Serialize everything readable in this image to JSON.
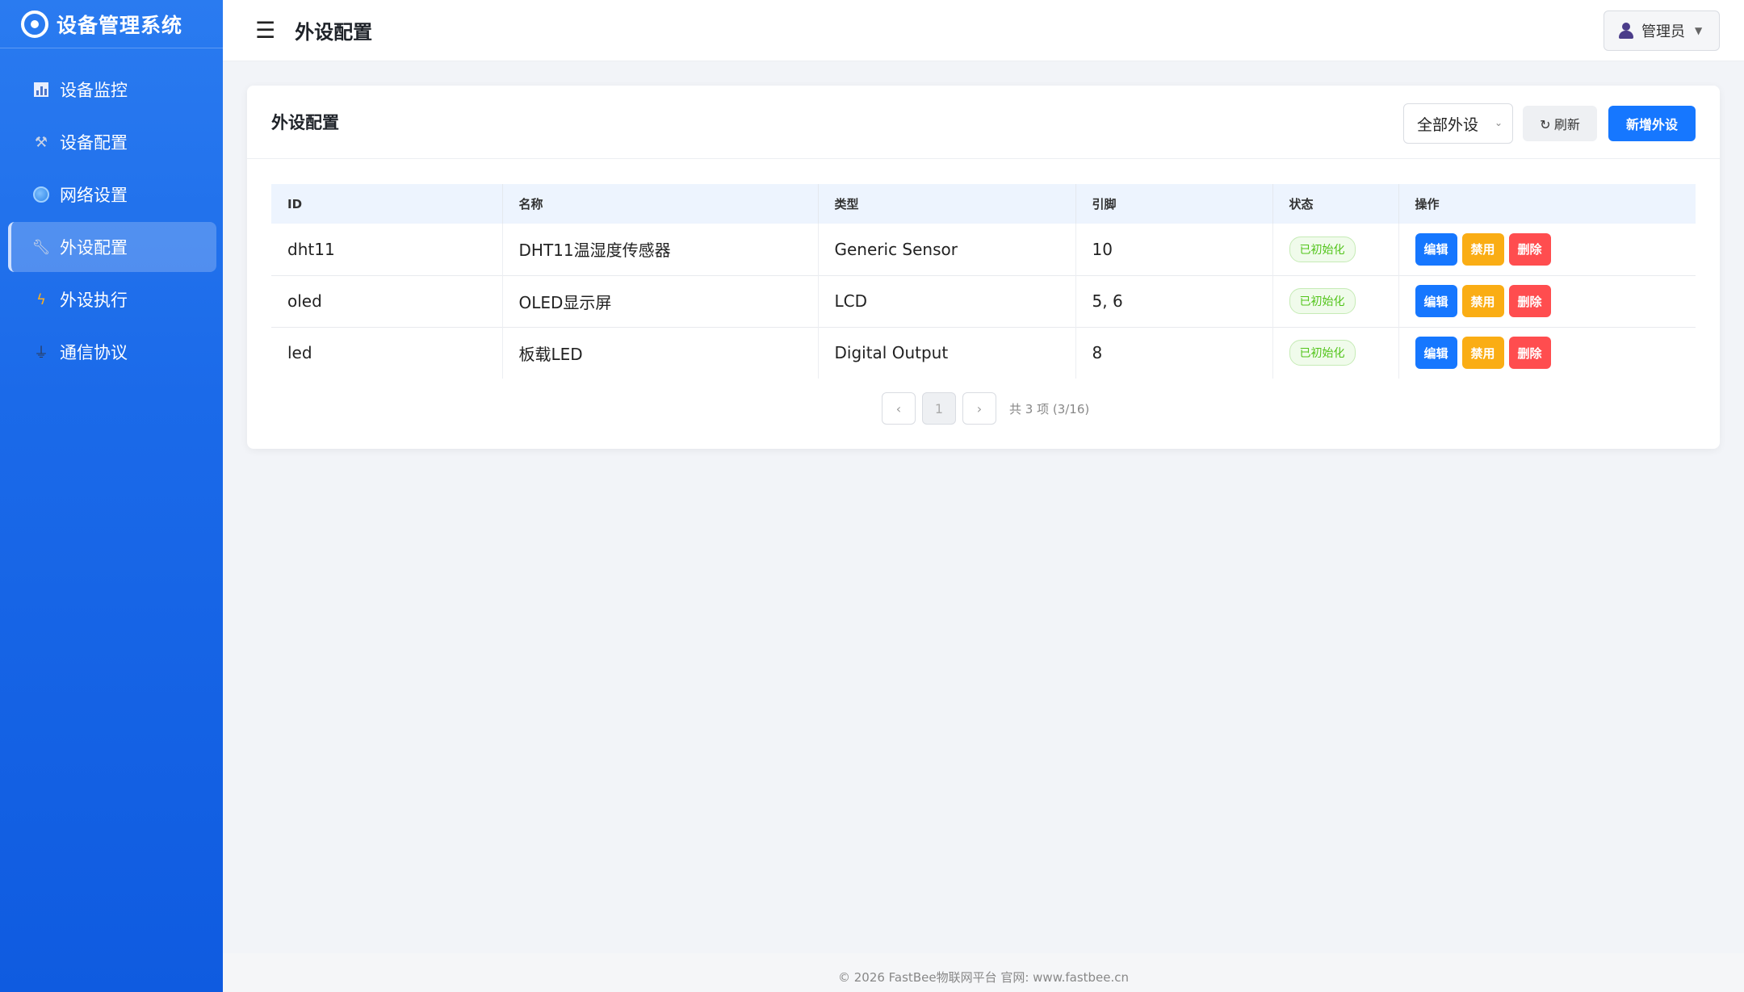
{
  "app": {
    "title": "设备管理系统"
  },
  "sidebar": {
    "items": [
      {
        "label": "设备监控",
        "icon": "bar-chart-icon"
      },
      {
        "label": "设备配置",
        "icon": "tools-icon"
      },
      {
        "label": "网络设置",
        "icon": "globe-icon"
      },
      {
        "label": "外设配置",
        "icon": "wrench-icon",
        "active": true
      },
      {
        "label": "外设执行",
        "icon": "lightning-icon"
      },
      {
        "label": "通信协议",
        "icon": "plug-icon"
      }
    ]
  },
  "header": {
    "menu_icon": "☰",
    "title": "外设配置",
    "user": "管理员",
    "caret": "▼"
  },
  "card": {
    "title": "外设配置",
    "filter": {
      "selected": "全部外设",
      "arrow": "⌄"
    },
    "refresh_label": "↻ 刷新",
    "add_label": "新增外设"
  },
  "table": {
    "columns": [
      "ID",
      "名称",
      "类型",
      "引脚",
      "状态",
      "操作"
    ],
    "rows": [
      {
        "id": "dht11",
        "name": "DHT11温湿度传感器",
        "type": "Generic Sensor",
        "pins": "10",
        "status": "已初始化"
      },
      {
        "id": "oled",
        "name": "OLED显示屏",
        "type": "LCD",
        "pins": "5, 6",
        "status": "已初始化"
      },
      {
        "id": "led",
        "name": "板载LED",
        "type": "Digital Output",
        "pins": "8",
        "status": "已初始化"
      }
    ],
    "actions": {
      "edit": "编辑",
      "disable": "禁用",
      "delete": "删除"
    }
  },
  "pagination": {
    "prev": "‹",
    "current": "1",
    "next": "›",
    "info": "共 3 项 (3/16)"
  },
  "footer": {
    "text": "© 2026 FastBee物联网平台 官网: www.fastbee.cn"
  },
  "colors": {
    "primary": "#1677ff",
    "warning": "#faad14",
    "danger": "#ff4d4f",
    "success": "#52c41a",
    "sidebar": "#1b6ae9"
  }
}
